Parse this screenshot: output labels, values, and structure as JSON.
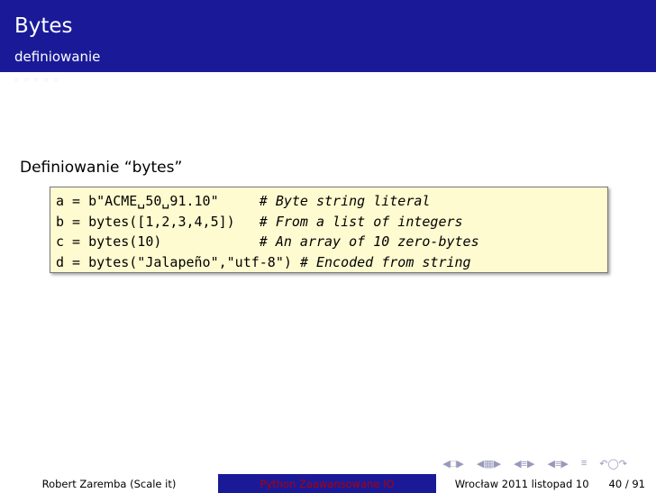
{
  "header": {
    "title": "Bytes",
    "subtitle": "definiowanie"
  },
  "block": {
    "title": "Definiowanie “bytes”",
    "code": [
      {
        "code": "a = b\"ACME␣50␣91.10\"     ",
        "comment": "# Byte string literal"
      },
      {
        "code": "b = bytes([1,2,3,4,5])   ",
        "comment": "# From a list of integers"
      },
      {
        "code": "c = bytes(10)            ",
        "comment": "# An array of 10 zero-bytes"
      },
      {
        "code": "d = bytes(\"Jalapeño\",\"utf-8\") ",
        "comment": "# Encoded from string"
      }
    ]
  },
  "footer": {
    "author": "Robert Zaremba  (Scale it)",
    "talk": "Python Zaawansowane IO",
    "place_date": "Wrocław 2011 listopad 10",
    "page": "40 / 91"
  },
  "colors": {
    "header_bg": "#1a1a99",
    "code_bg": "#fffbd0"
  }
}
